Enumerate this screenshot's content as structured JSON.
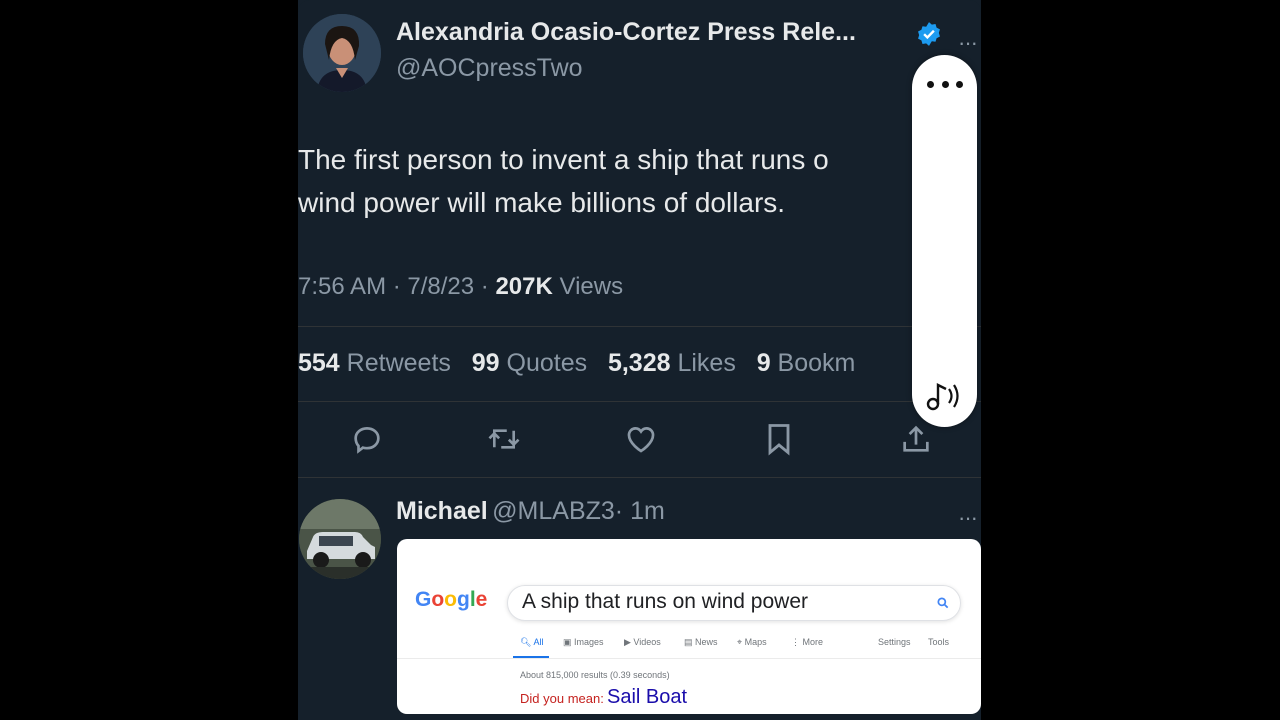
{
  "tweet": {
    "author_name": "Alexandria Ocasio-Cortez Press Rele...",
    "author_handle": "@AOCpressTwo",
    "verified": true,
    "text_line1": "The first person to invent a ship that runs o",
    "text_line2": "wind power will make billions of dollars.",
    "time": "7:56 AM · 7/8/23 ·",
    "views_count": "207K",
    "views_label": "Views",
    "stats": [
      {
        "count": "554",
        "label": "Retweets"
      },
      {
        "count": "99",
        "label": "Quotes"
      },
      {
        "count": "5,328",
        "label": "Likes"
      },
      {
        "count": "9",
        "label": "Bookm"
      }
    ],
    "actions": [
      "reply-icon",
      "retweet-icon",
      "like-icon",
      "bookmark-icon",
      "share-icon"
    ]
  },
  "reply": {
    "author_name": "Michael",
    "author_handle": "@MLABZ3",
    "time": "· 1m"
  },
  "google_card": {
    "logo": "Google",
    "query": "A ship that runs on wind power",
    "tabs": [
      "All",
      "Images",
      "Videos",
      "News",
      "Maps",
      "More"
    ],
    "right_tabs": [
      "Settings",
      "Tools"
    ],
    "result_stats": "About 815,000 results (0.39 seconds)",
    "did_you_mean": "Did you mean:",
    "suggestion": "Sail Boat"
  },
  "overlay": {
    "menu_icon": "more-dots-icon",
    "audio_icon": "audio-note-icon"
  },
  "colors": {
    "background": "#15202b",
    "text": "#e7e9ea",
    "muted": "#8b98a5",
    "verified": "#1d9bf0",
    "google_link": "#1a0dab",
    "google_dym": "#c5221f"
  }
}
